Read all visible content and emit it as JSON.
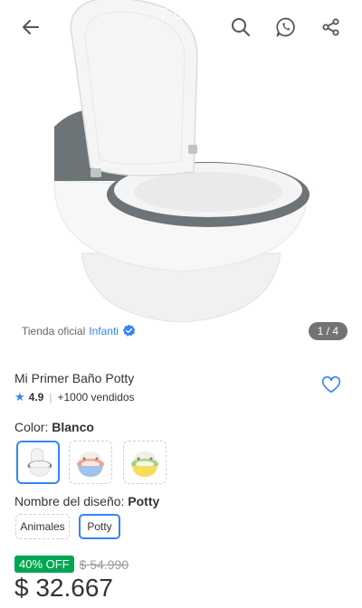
{
  "overlay_text": "7 d",
  "gallery": {
    "counter": "1 / 4",
    "store_prefix": "Tienda oficial",
    "store_name": "Infanti"
  },
  "product": {
    "title": "Mi Primer Baño Potty",
    "rating": "4.9",
    "sold": "+1000 vendidos"
  },
  "color": {
    "label": "Color: ",
    "selected": "Blanco",
    "swatches": [
      {
        "name": "white-grey potty",
        "selected": true
      },
      {
        "name": "pink-blue potty",
        "selected": false
      },
      {
        "name": "yellow-green potty",
        "selected": false
      }
    ]
  },
  "design": {
    "label": "Nombre del diseño: ",
    "selected": "Potty",
    "options": [
      "Animales",
      "Potty"
    ]
  },
  "pricing": {
    "discount": "40% OFF",
    "old_price": "$ 54.990",
    "price": "$ 32.667"
  },
  "colors": {
    "accent": "#3483fa",
    "discount_green": "#00a650",
    "text": "#333333"
  },
  "icons": [
    "back-arrow-icon",
    "search-icon",
    "whatsapp-icon",
    "share-icon",
    "verified-icon",
    "heart-icon",
    "star-icon"
  ]
}
